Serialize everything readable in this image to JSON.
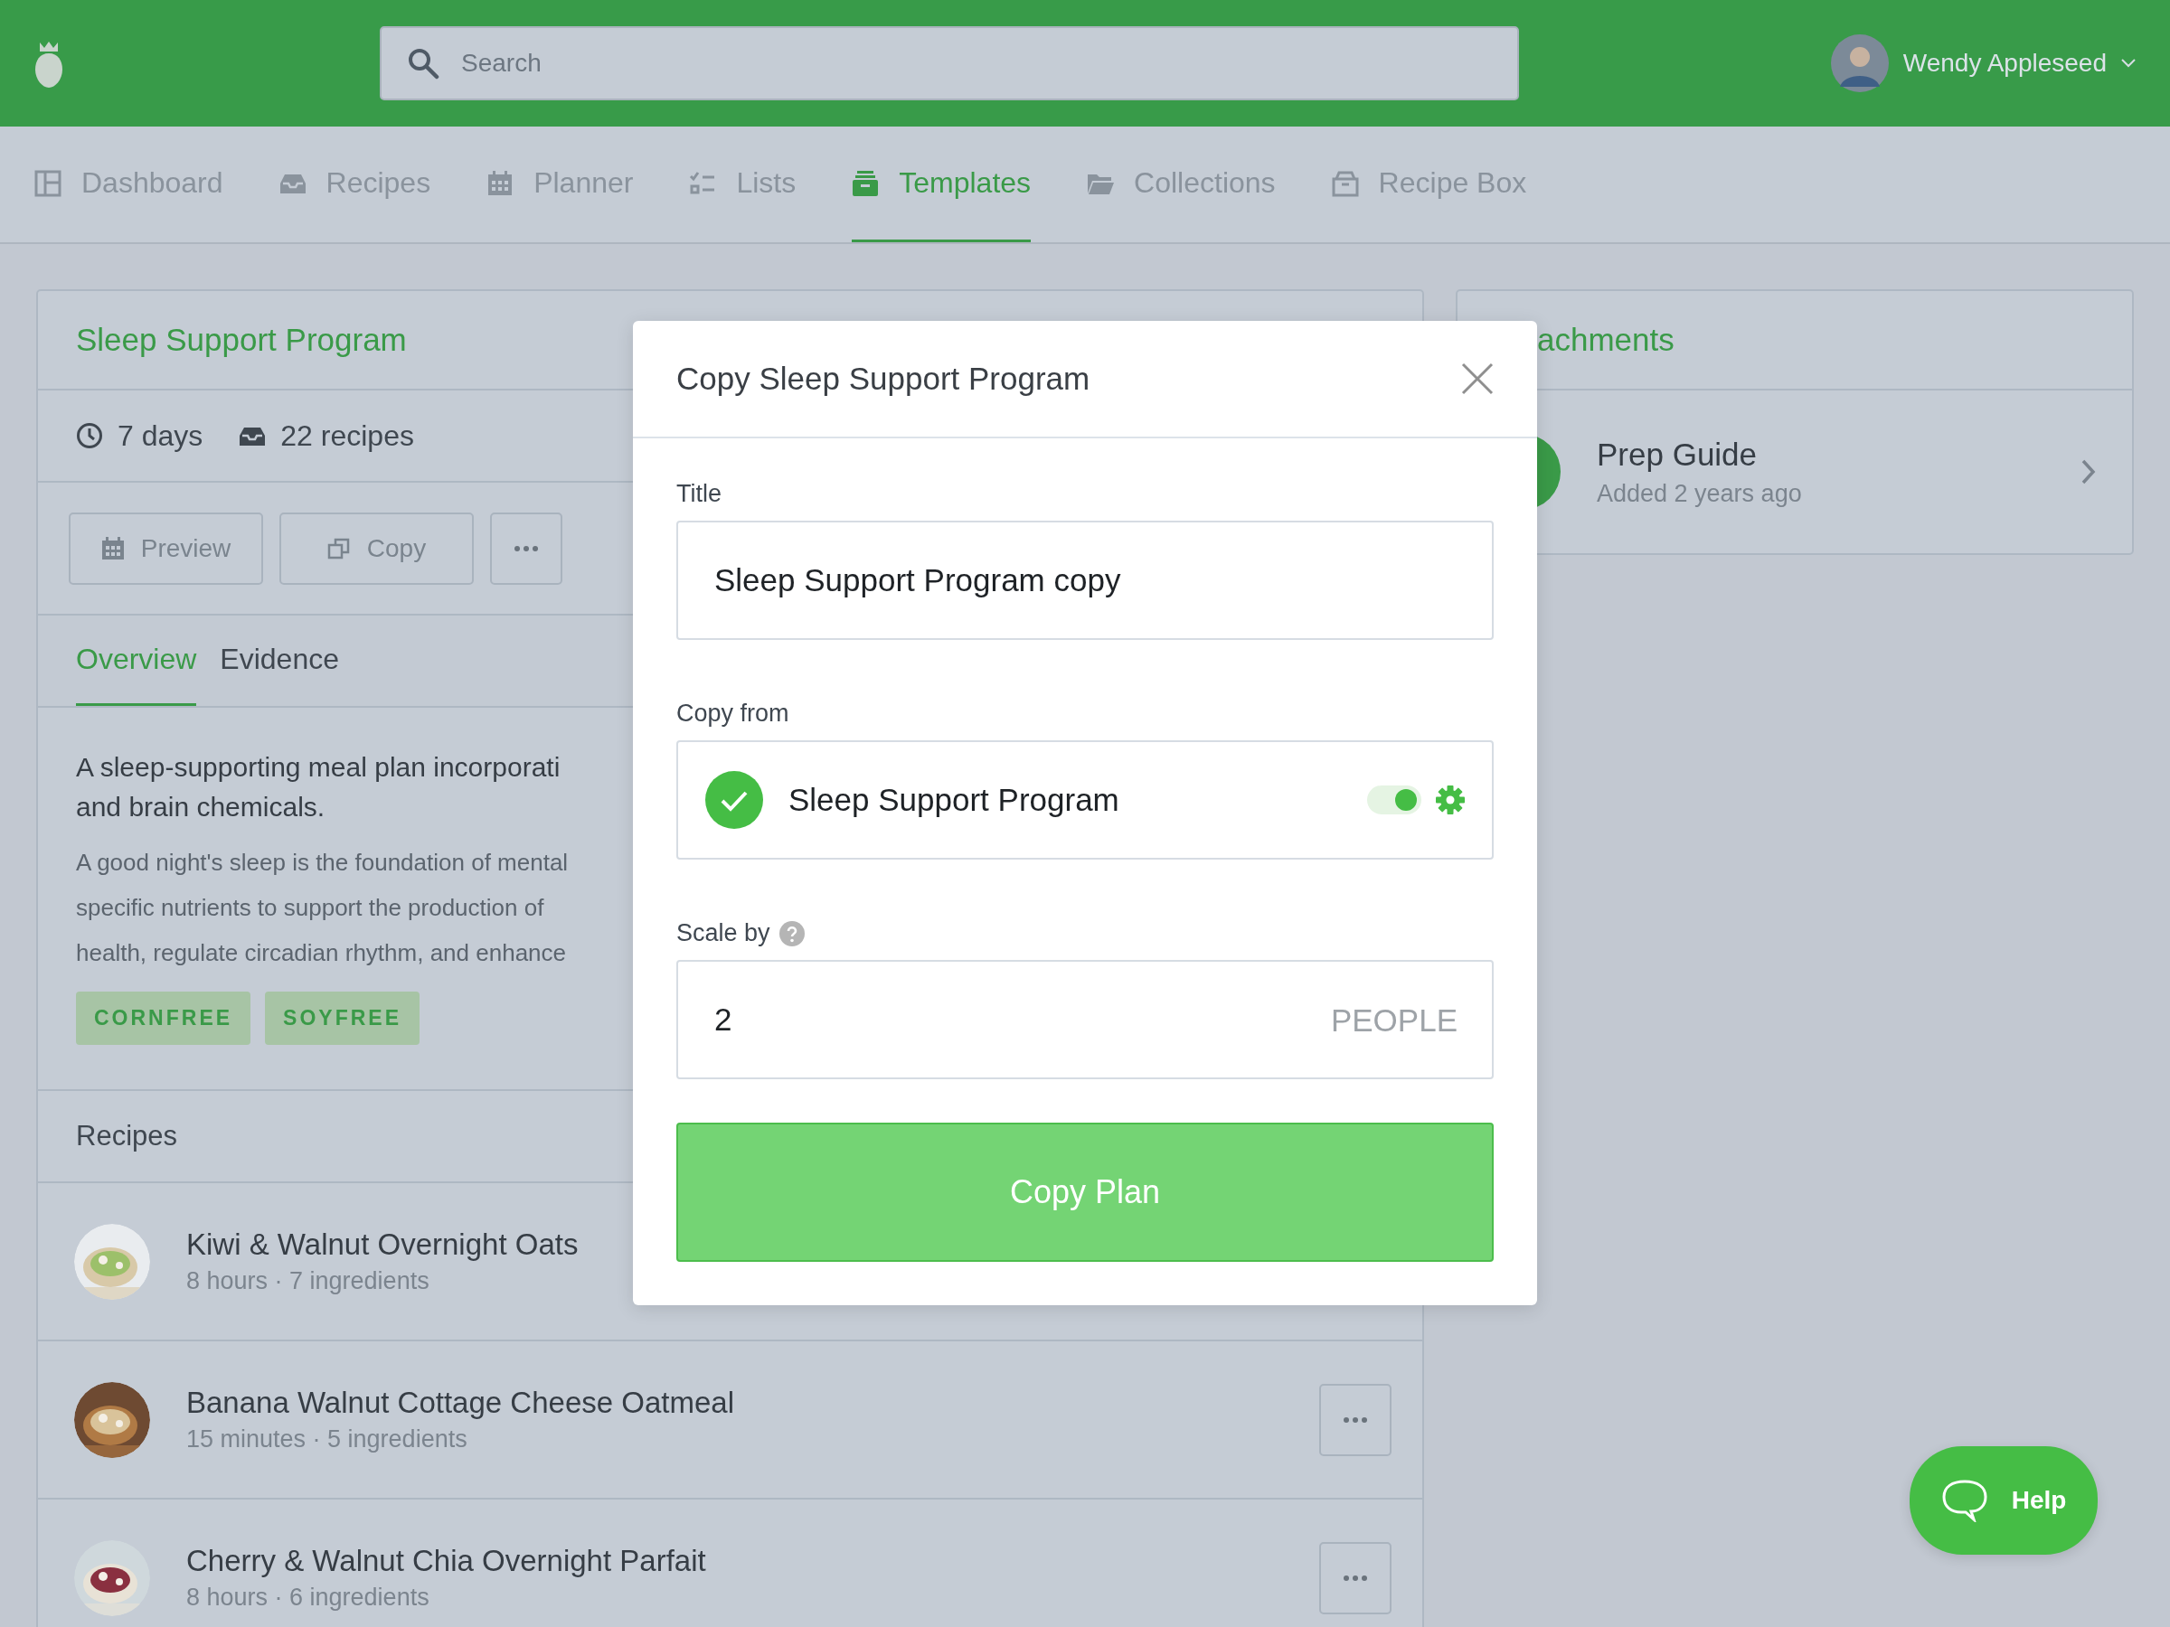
{
  "search": {
    "placeholder": "Search"
  },
  "user": {
    "name": "Wendy Appleseed"
  },
  "nav": [
    {
      "label": "Dashboard",
      "selected": false
    },
    {
      "label": "Recipes",
      "selected": false
    },
    {
      "label": "Planner",
      "selected": false
    },
    {
      "label": "Lists",
      "selected": false
    },
    {
      "label": "Templates",
      "selected": true
    },
    {
      "label": "Collections",
      "selected": false
    },
    {
      "label": "Recipe Box",
      "selected": false
    }
  ],
  "plan": {
    "title": "Sleep Support Program",
    "meta": [
      "7 days",
      "22 recipes"
    ],
    "actions": [
      {
        "kind": "button",
        "label": "Preview"
      },
      {
        "kind": "button",
        "label": "Copy"
      },
      {
        "kind": "more"
      }
    ],
    "tabs": [
      {
        "label": "Overview",
        "selected": true
      },
      {
        "label": "Evidence",
        "selected": false
      }
    ],
    "summary_lines": [
      "A sleep-supporting meal plan incorporati",
      "and brain chemicals."
    ],
    "body_lines": [
      "A good night's sleep is the foundation of mental",
      "specific nutrients to support the production of",
      "health, regulate circadian rhythm, and enhance"
    ],
    "tags": [
      "CORNFREE",
      "SOYFREE"
    ],
    "recipes_heading": "Recipes",
    "recipes": [
      {
        "name": "Kiwi & Walnut Overnight Oats",
        "details": "8 hours · 7 ingredients",
        "more_button": false
      },
      {
        "name": "Banana Walnut Cottage Cheese Oatmeal",
        "details": "15 minutes · 5 ingredients",
        "more_button": true
      },
      {
        "name": "Cherry & Walnut Chia Overnight Parfait",
        "details": "8 hours · 6 ingredients",
        "more_button": true
      }
    ]
  },
  "attachments": {
    "title": "achments",
    "items": [
      {
        "name": "Prep Guide",
        "added": "Added 2 years ago"
      }
    ]
  },
  "modal": {
    "title": "Copy Sleep Support Program",
    "title_field": {
      "label": "Title",
      "value": "Sleep Support Program copy"
    },
    "copy_from": {
      "label": "Copy from",
      "value": "Sleep Support Program",
      "checked": true,
      "toggle_on": true
    },
    "scale": {
      "label": "Scale by",
      "value": "2",
      "unit": "PEOPLE"
    },
    "submit": "Copy Plan"
  },
  "help": {
    "label": "Help"
  }
}
